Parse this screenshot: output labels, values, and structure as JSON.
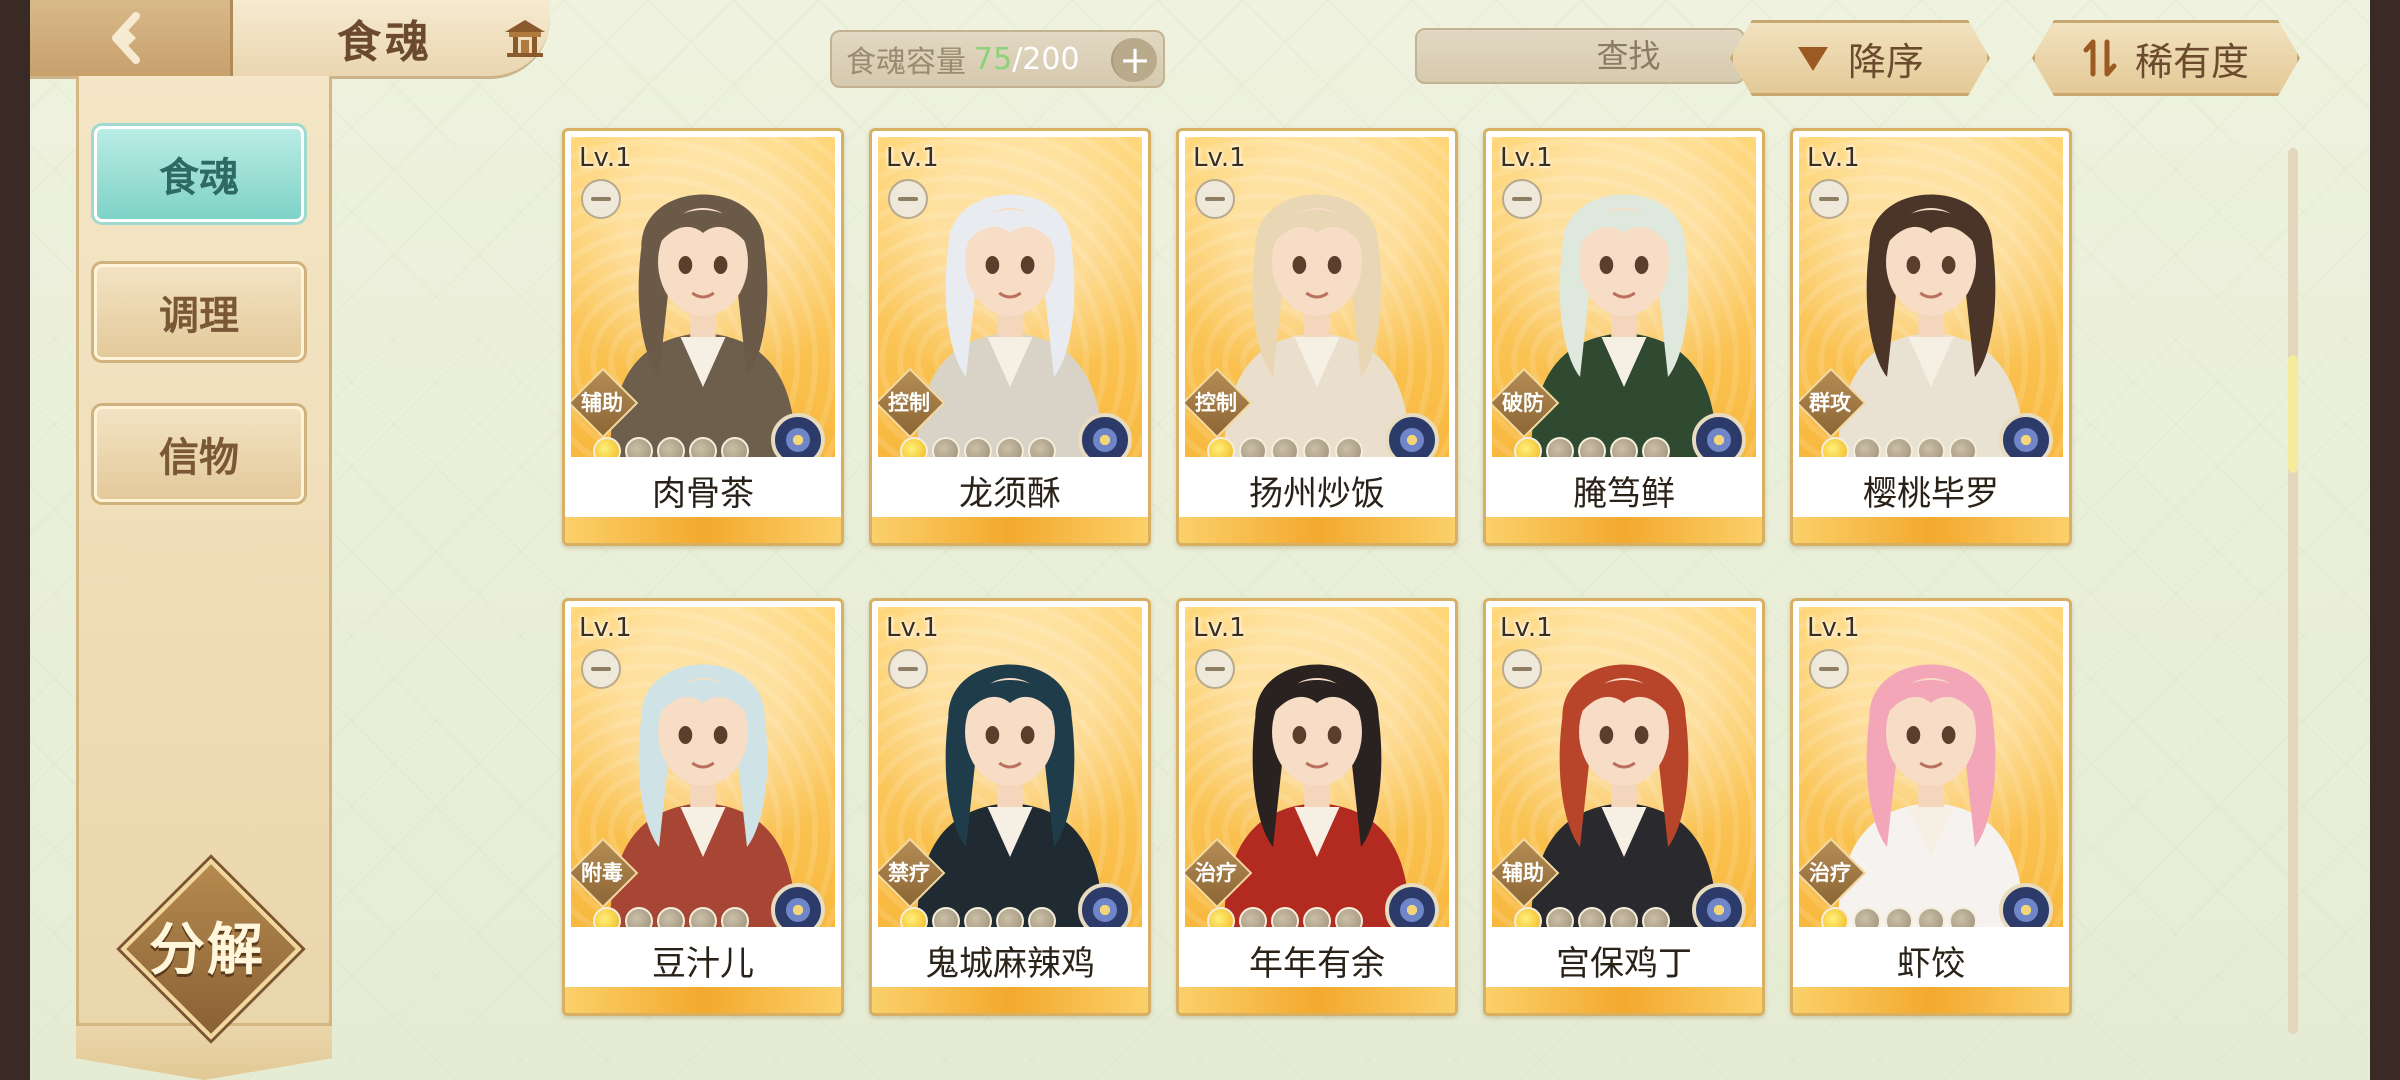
{
  "header": {
    "title": "食魂"
  },
  "capacity": {
    "label": "食魂容量",
    "current": "75",
    "separator": "/",
    "max": "200"
  },
  "search": {
    "placeholder": "查找"
  },
  "sort": {
    "order_label": "降序",
    "field_label": "稀有度"
  },
  "sidebar": {
    "items": [
      {
        "label": "食魂",
        "active": true
      },
      {
        "label": "调理",
        "active": false
      },
      {
        "label": "信物",
        "active": false
      }
    ],
    "decompose_label": "分解"
  },
  "scroll": {
    "position": 0.27
  },
  "cards": [
    {
      "level": "Lv.1",
      "role": "辅助",
      "name": "肉骨茶",
      "stars": 1,
      "hair": "#6b5a48",
      "outfit": "#6e5e4c",
      "bg": "#ffd36e"
    },
    {
      "level": "Lv.1",
      "role": "控制",
      "name": "龙须酥",
      "stars": 1,
      "hair": "#e8ecf0",
      "outfit": "#d8d3c6",
      "bg": "#ffd36e"
    },
    {
      "level": "Lv.1",
      "role": "控制",
      "name": "扬州炒饭",
      "stars": 1,
      "hair": "#e8d6b4",
      "outfit": "#e9dfcc",
      "bg": "#ffd36e"
    },
    {
      "level": "Lv.1",
      "role": "破防",
      "name": "腌笃鲜",
      "stars": 1,
      "hair": "#dfe8dc",
      "outfit": "#2f4a30",
      "bg": "#ffd36e"
    },
    {
      "level": "Lv.1",
      "role": "群攻",
      "name": "樱桃毕罗",
      "stars": 1,
      "hair": "#4a3528",
      "outfit": "#e9e2d2",
      "bg": "#ffd36e"
    },
    {
      "level": "Lv.1",
      "role": "附毒",
      "name": "豆汁儿",
      "stars": 1,
      "hair": "#cfe3e6",
      "outfit": "#a84636",
      "bg": "#ffd36e"
    },
    {
      "level": "Lv.1",
      "role": "禁疗",
      "name": "鬼城麻辣鸡",
      "stars": 1,
      "hair": "#1f3c4a",
      "outfit": "#1f2a33",
      "bg": "#ffd36e"
    },
    {
      "level": "Lv.1",
      "role": "治疗",
      "name": "年年有余",
      "stars": 1,
      "hair": "#2a2220",
      "outfit": "#b22a20",
      "bg": "#ffd36e"
    },
    {
      "level": "Lv.1",
      "role": "辅助",
      "name": "宫保鸡丁",
      "stars": 1,
      "hair": "#b8452a",
      "outfit": "#2a2a2e",
      "bg": "#ffd36e"
    },
    {
      "level": "Lv.1",
      "role": "治疗",
      "name": "虾饺",
      "stars": 1,
      "hair": "#f2a6b8",
      "outfit": "#f6f2f0",
      "bg": "#ffd36e"
    }
  ]
}
